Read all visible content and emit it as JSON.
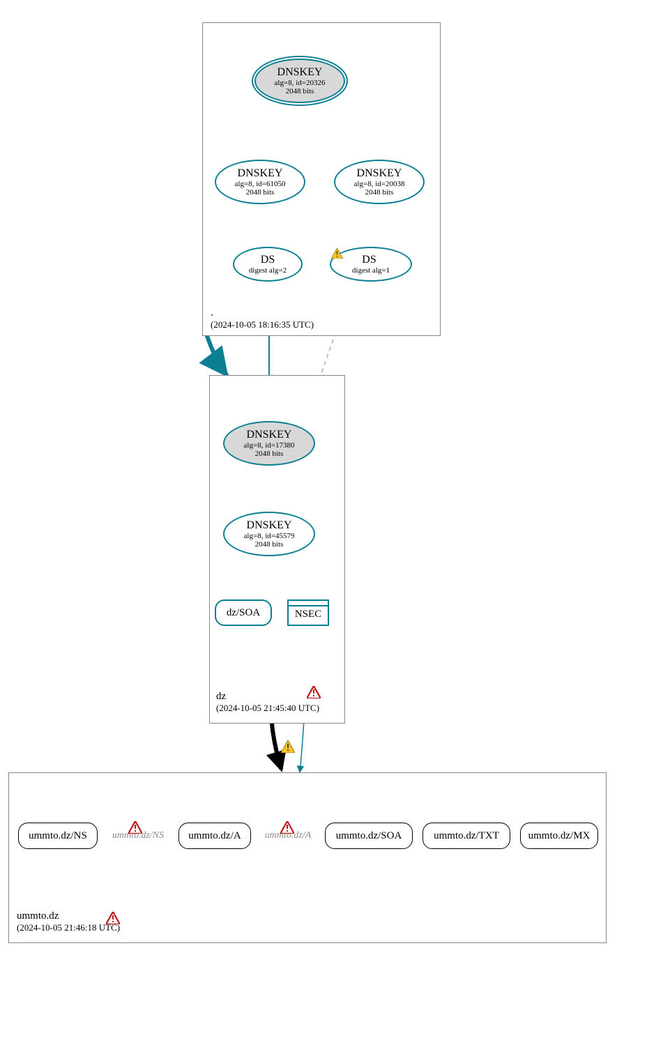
{
  "zones": {
    "root": {
      "name": ".",
      "timestamp": "(2024-10-05 18:16:35 UTC)",
      "nodes": {
        "ksk": {
          "title": "DNSKEY",
          "line2": "alg=8, id=20326",
          "line3": "2048 bits"
        },
        "zsk": {
          "title": "DNSKEY",
          "line2": "alg=8, id=61050",
          "line3": "2048 bits"
        },
        "other": {
          "title": "DNSKEY",
          "line2": "alg=8, id=20038",
          "line3": "2048 bits"
        },
        "ds2": {
          "title": "DS",
          "line2": "digest alg=2"
        },
        "ds1": {
          "title": "DS",
          "line2": "digest alg=1"
        }
      }
    },
    "dz": {
      "name": "dz",
      "timestamp": "(2024-10-05 21:45:40 UTC)",
      "nodes": {
        "ksk": {
          "title": "DNSKEY",
          "line2": "alg=8, id=17380",
          "line3": "2048 bits"
        },
        "zsk": {
          "title": "DNSKEY",
          "line2": "alg=8, id=45579",
          "line3": "2048 bits"
        },
        "soa": {
          "title": "dz/SOA"
        },
        "nsec": {
          "title": "NSEC"
        }
      }
    },
    "ummto": {
      "name": "ummto.dz",
      "timestamp": "(2024-10-05 21:46:18 UTC)",
      "nodes": {
        "ns": {
          "title": "ummto.dz/NS"
        },
        "ns_grey": {
          "title": "ummto.dz/NS"
        },
        "a": {
          "title": "ummto.dz/A"
        },
        "a_grey": {
          "title": "ummto.dz/A"
        },
        "soa": {
          "title": "ummto.dz/SOA"
        },
        "txt": {
          "title": "ummto.dz/TXT"
        },
        "mx": {
          "title": "ummto.dz/MX"
        }
      }
    }
  }
}
